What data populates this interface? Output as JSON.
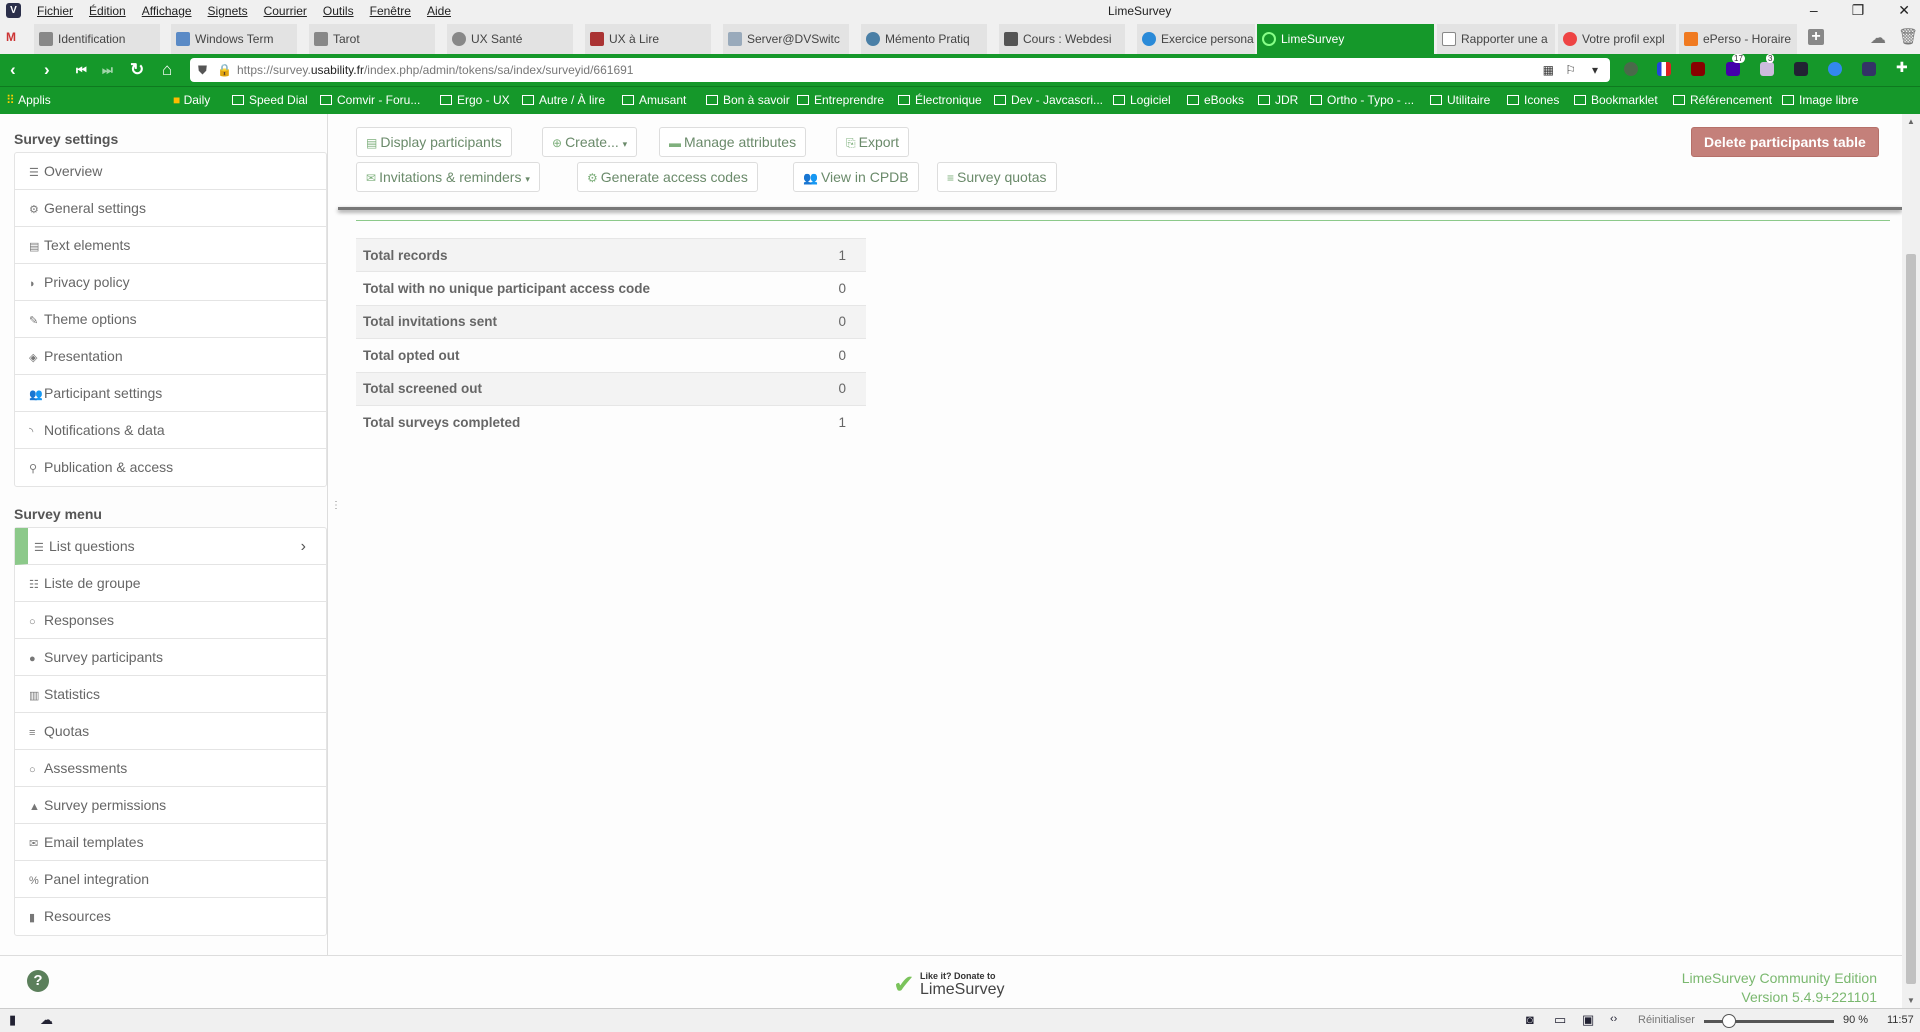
{
  "window": {
    "title": "LimeSurvey",
    "menus": [
      "Fichier",
      "Édition",
      "Affichage",
      "Signets",
      "Courrier",
      "Outils",
      "Fenêtre",
      "Aide"
    ]
  },
  "tabs": [
    {
      "label": "Identification"
    },
    {
      "label": "Windows Term"
    },
    {
      "label": "Tarot"
    },
    {
      "label": "UX Santé"
    },
    {
      "label": "UX à Lire"
    },
    {
      "label": "Server@DVSwitc"
    },
    {
      "label": "Mémento Pratiq"
    },
    {
      "label": "Cours : Webdesi"
    },
    {
      "label": "Exercice persona"
    },
    {
      "label": "LimeSurvey",
      "active": true
    },
    {
      "label": "Rapporter une a"
    },
    {
      "label": "Votre profil expl"
    },
    {
      "label": "ePerso - Horaire"
    }
  ],
  "address": {
    "prefix": "https://survey.",
    "domain": "usability.fr",
    "path": "/index.php/admin/tokens/sa/index/surveyid/661691"
  },
  "extensions": {
    "badge1": "17",
    "badge2": "3"
  },
  "bookmarks": [
    "Applis",
    "Daily",
    "Speed Dial",
    "Comvir - Foru...",
    "Ergo - UX",
    "Autre / À lire",
    "Amusant",
    "Bon à savoir",
    "Entreprendre",
    "Électronique",
    "Dev - Javcascri...",
    "Logiciel",
    "eBooks",
    "JDR",
    "Ortho - Typo - ...",
    "Utilitaire",
    "Icones",
    "Bookmarklet",
    "Référencement",
    "Image libre"
  ],
  "sidebar": {
    "settings_title": "Survey settings",
    "settings": [
      {
        "icon": "☰",
        "label": "Overview"
      },
      {
        "icon": "⚙",
        "label": "General settings"
      },
      {
        "icon": "▤",
        "label": "Text elements"
      },
      {
        "icon": "◗",
        "label": "Privacy policy"
      },
      {
        "icon": "✎",
        "label": "Theme options"
      },
      {
        "icon": "◈",
        "label": "Presentation"
      },
      {
        "icon": "👥",
        "label": "Participant settings"
      },
      {
        "icon": "◝",
        "label": "Notifications & data"
      },
      {
        "icon": "⚲",
        "label": "Publication & access"
      }
    ],
    "menu_title": "Survey menu",
    "menu": [
      {
        "icon": "☰",
        "label": "List questions"
      },
      {
        "icon": "☷",
        "label": "Liste de groupe"
      },
      {
        "icon": "○",
        "label": "Responses"
      },
      {
        "icon": "●",
        "label": "Survey participants"
      },
      {
        "icon": "▥",
        "label": "Statistics"
      },
      {
        "icon": "≡",
        "label": "Quotas"
      },
      {
        "icon": "○",
        "label": "Assessments"
      },
      {
        "icon": "▲",
        "label": "Survey permissions"
      },
      {
        "icon": "✉",
        "label": "Email templates"
      },
      {
        "icon": "%",
        "label": "Panel integration"
      },
      {
        "icon": "▮",
        "label": "Resources"
      }
    ]
  },
  "toolbar": {
    "display": "Display participants",
    "create": "Create...",
    "manage": "Manage attributes",
    "export": "Export",
    "invitations": "Invitations & reminders",
    "generate": "Generate access codes",
    "cpdb": "View in CPDB",
    "quotas": "Survey quotas",
    "delete": "Delete participants table"
  },
  "stats": [
    {
      "label": "Total records",
      "value": "1"
    },
    {
      "label": "Total with no unique participant access code",
      "value": "0"
    },
    {
      "label": "Total invitations sent",
      "value": "0"
    },
    {
      "label": "Total opted out",
      "value": "0"
    },
    {
      "label": "Total screened out",
      "value": "0"
    },
    {
      "label": "Total surveys completed",
      "value": "1"
    }
  ],
  "footer": {
    "donate_line1": "Like it? Donate to",
    "donate_line2": "LimeSurvey",
    "edition": "LimeSurvey Community Edition",
    "version": "Version 5.4.9+221101"
  },
  "statusbar": {
    "reset": "Réinitialiser",
    "zoom": "90 %",
    "time": "11:57",
    "zoom_percent": 90
  }
}
